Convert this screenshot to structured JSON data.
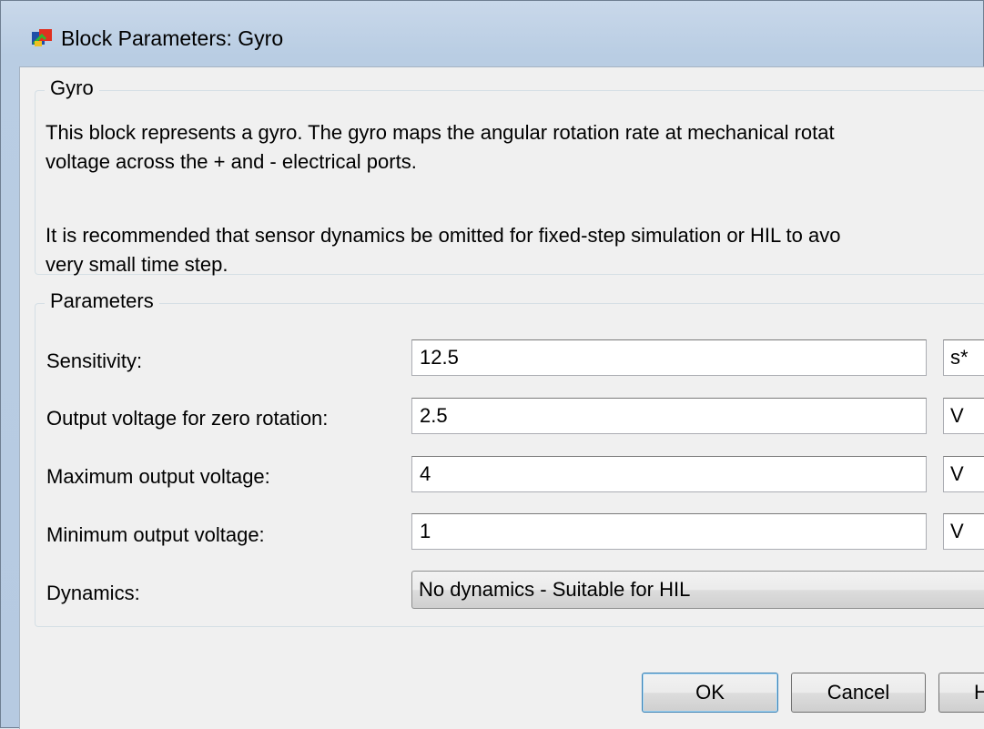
{
  "window": {
    "title": "Block Parameters: Gyro"
  },
  "description_group": {
    "legend": "Gyro",
    "paragraph_1_line_1": "This block represents a gyro. The gyro maps the angular rotation rate at mechanical rotat",
    "paragraph_1_line_2": "voltage across the + and - electrical ports.",
    "paragraph_2_line_1": "It is recommended that sensor dynamics be omitted for fixed-step simulation or HIL to avo",
    "paragraph_2_line_2": "very small time step."
  },
  "parameters_group": {
    "legend": "Parameters",
    "fields": [
      {
        "label": "Sensitivity:",
        "value": "12.5",
        "unit": "s*"
      },
      {
        "label": "Output voltage for zero rotation:",
        "value": "2.5",
        "unit": "V"
      },
      {
        "label": "Maximum output voltage:",
        "value": "4",
        "unit": "V"
      },
      {
        "label": "Minimum output voltage:",
        "value": "1",
        "unit": "V"
      }
    ],
    "dynamics": {
      "label": "Dynamics:",
      "selected": "No dynamics - Suitable for HIL"
    }
  },
  "buttons": {
    "ok": "OK",
    "cancel": "Cancel",
    "help": "H"
  },
  "icons": {
    "app": "simulink-block-icon"
  },
  "colors": {
    "title_bar": "#b9cde3",
    "client_bg": "#f0f0f0",
    "ok_border": "#3c7fb1"
  }
}
